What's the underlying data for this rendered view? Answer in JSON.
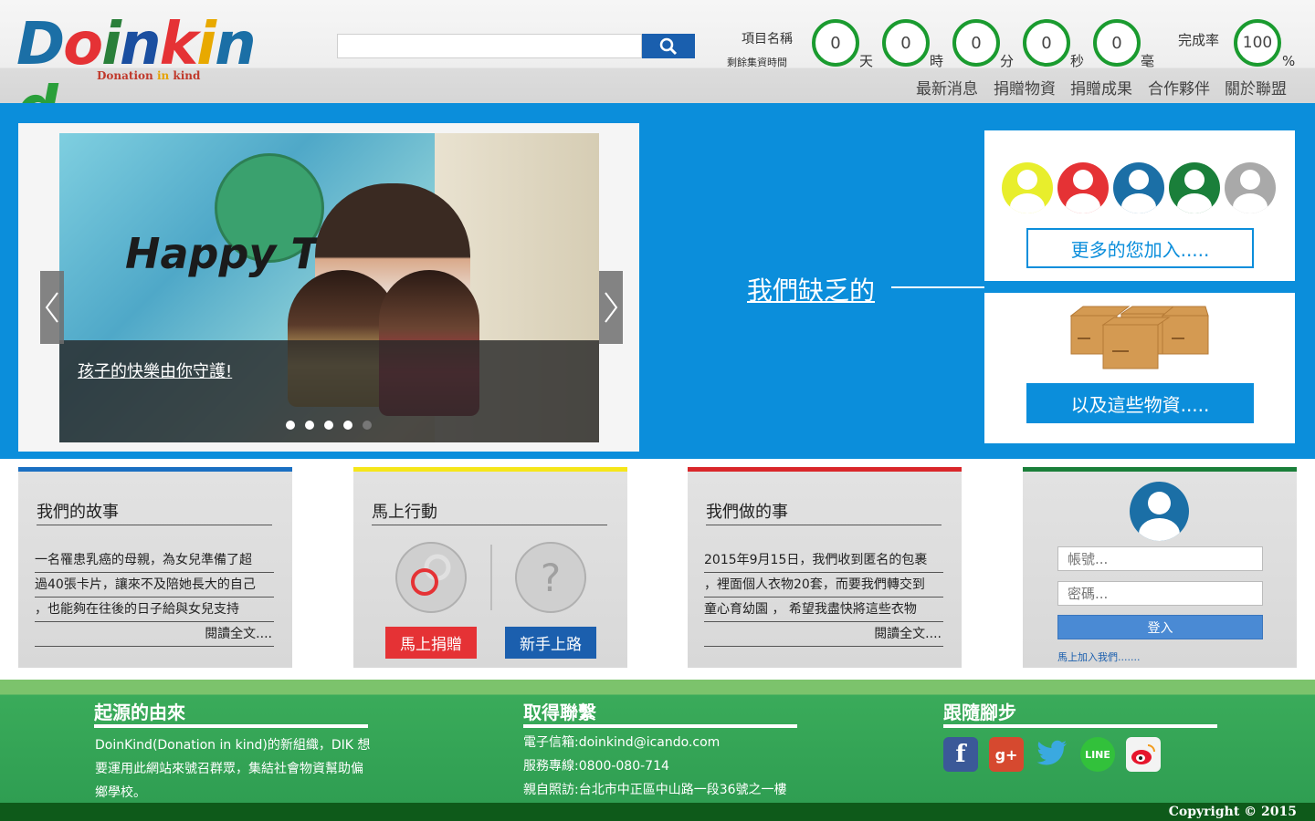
{
  "logo": {
    "text": "Doinkind",
    "tagline_pre": "Donation",
    "tagline_in": "in",
    "tagline_post": "kind"
  },
  "search": {
    "value": "",
    "placeholder": ""
  },
  "timer": {
    "project_label": "項目名稱",
    "remaining_label": "剩餘集資時間",
    "days": "0",
    "days_unit": "天",
    "hours": "0",
    "hours_unit": "時",
    "minutes": "0",
    "minutes_unit": "分",
    "seconds": "0",
    "seconds_unit": "秒",
    "millis": "0",
    "millis_unit": "毫",
    "rate_label": "完成率",
    "rate_value": "100",
    "rate_unit": "%"
  },
  "nav": [
    "最新消息",
    "捐贈物資",
    "捐贈成果",
    "合作夥伴",
    "關於聯盟"
  ],
  "hero": {
    "slide_caption": "孩子的快樂由你守護!",
    "slide_sign": "Happy T",
    "lack_label": "我們缺乏的",
    "more_join": "更多的您加入.....",
    "supplies": "以及這些物資.....",
    "avatar_colors": [
      "#e8ee2c",
      "#e53235",
      "#1b6fa6",
      "#1a7f3a",
      "#a9a9a9"
    ]
  },
  "story": {
    "title": "我們的故事",
    "lines": [
      "一名罹患乳癌的母親，為女兒準備了超",
      "過40張卡片，讓來不及陪她長大的自己",
      "，也能夠在往後的日子給與女兒支持"
    ],
    "more": "閱讀全文....",
    "color": "#1a6fc2"
  },
  "action": {
    "title": "馬上行動",
    "donate": "馬上捐贈",
    "newbie": "新手上路",
    "color": "#f5e61a"
  },
  "work": {
    "title": "我們做的事",
    "lines": [
      "2015年9月15日，我們收到匿名的包裹",
      "，裡面個人衣物20套，而要我們轉交到",
      "童心育幼園 ， 希望我盡快將這些衣物"
    ],
    "more": "閱讀全文....",
    "color": "#d9262a"
  },
  "login": {
    "account_placeholder": "帳號...",
    "password_placeholder": "密碼...",
    "button": "登入",
    "join": "馬上加入我們.......",
    "color": "#1a7f3a"
  },
  "footer": {
    "origin_title": "起源的由來",
    "origin_lines": [
      "DoinKind(Donation in kind)的新組織，DIK 想",
      "要運用此網站來號召群眾，集結社會物資幫助偏",
      "鄉學校。"
    ],
    "contact_title": "取得聯繫",
    "contact_lines": [
      "電子信箱:doinkind@icando.com",
      "服務專線:0800-080-714",
      "親自照訪:台北市中正區中山路一段36號之一樓"
    ],
    "follow_title": "跟隨腳步",
    "copyright": "Copyright © 2015"
  }
}
